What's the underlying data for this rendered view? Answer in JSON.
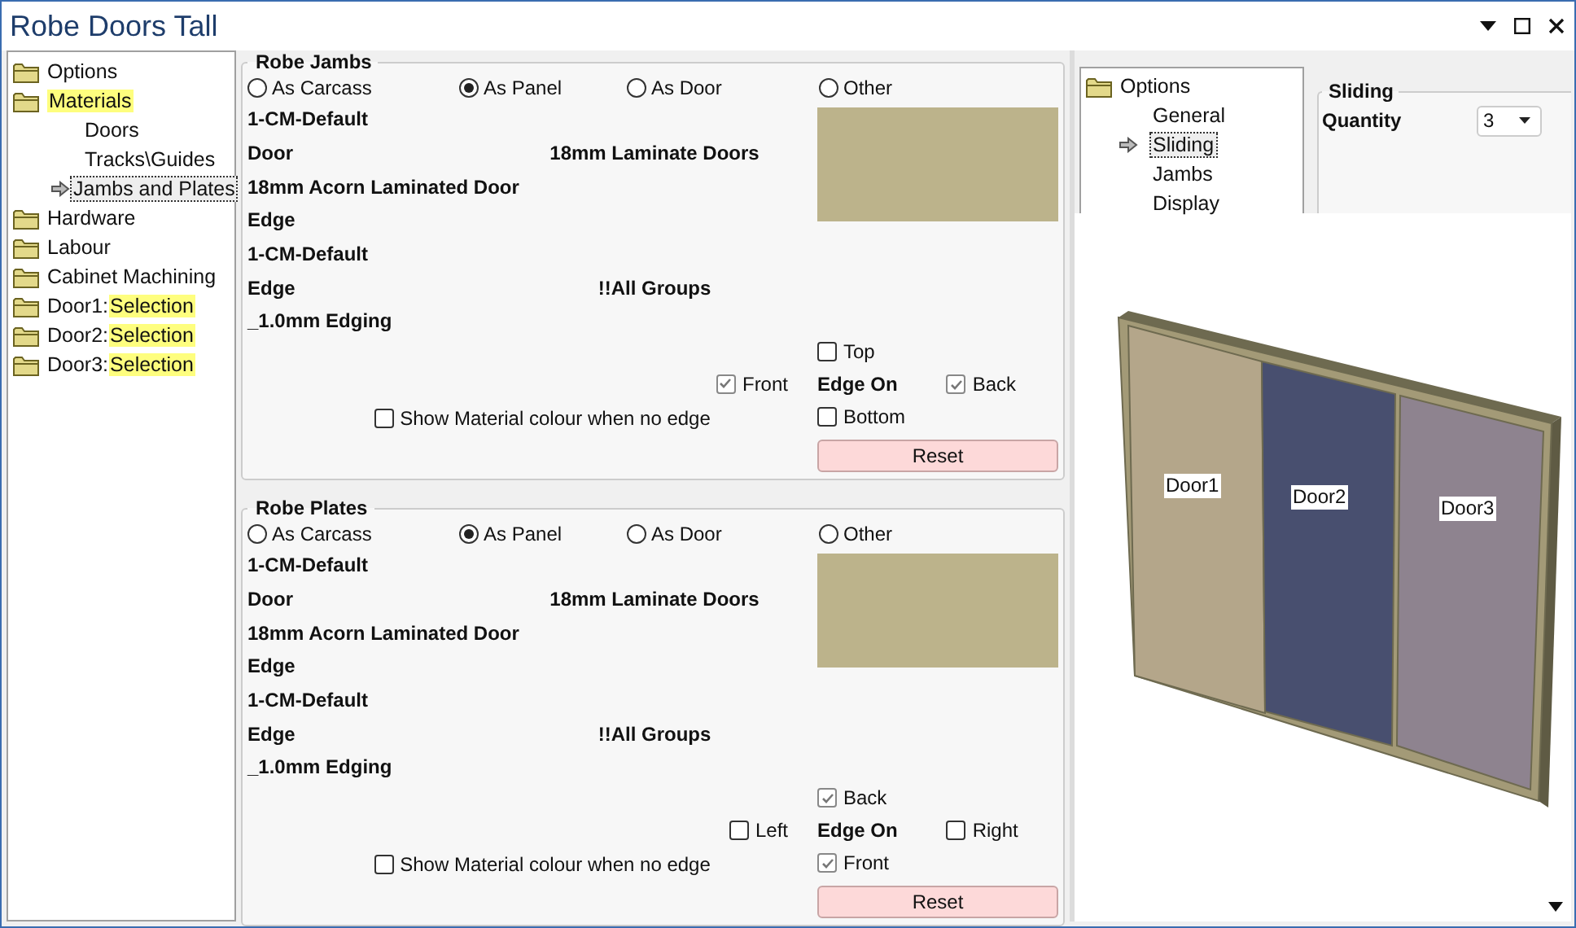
{
  "window": {
    "title": "Robe Doors Tall"
  },
  "tree": [
    {
      "label": "Options",
      "highlighted": false
    },
    {
      "label": "Materials",
      "highlighted": true,
      "children": [
        {
          "label": "Doors",
          "selected": false
        },
        {
          "label": "Tracks\\Guides",
          "selected": false
        },
        {
          "label": "Jambs and Plates",
          "selected": true
        }
      ]
    },
    {
      "label": "Hardware",
      "highlighted": false
    },
    {
      "label": "Labour",
      "highlighted": false
    },
    {
      "label": "Cabinet Machining",
      "highlighted": false
    },
    {
      "label": "Door1:",
      "highlight": "Selection",
      "highlighted": false
    },
    {
      "label": "Door2:",
      "highlight": "Selection",
      "highlighted": false
    },
    {
      "label": "Door3:",
      "highlight": "Selection",
      "highlighted": false
    }
  ],
  "panels": [
    {
      "title": "Robe Jambs",
      "options": [
        {
          "label": "As Carcass",
          "selected": false
        },
        {
          "label": "As Panel",
          "selected": true
        },
        {
          "label": "As Door",
          "selected": false
        },
        {
          "label": "Other",
          "selected": false
        }
      ],
      "lines": [
        {
          "text": "1-CM-Default"
        },
        {
          "text": "Door",
          "value": "18mm Laminate Doors"
        },
        {
          "text": "18mm Acorn Laminated Door"
        },
        {
          "text": "Edge"
        },
        {
          "text": "1-CM-Default"
        },
        {
          "text": "Edge",
          "value": "!!All Groups"
        },
        {
          "text": "_1.0mm Edging"
        }
      ],
      "edge": {
        "label": "Edge On",
        "top": {
          "label": "Top",
          "checked": false
        },
        "left": {
          "label": "Front",
          "checked": true
        },
        "right": {
          "label": "Back",
          "checked": true
        },
        "bottom": {
          "label": "Bottom",
          "checked": false
        }
      },
      "show_colour": {
        "label": "Show Material colour when no edge",
        "checked": false
      },
      "reset": "Reset"
    },
    {
      "title": "Robe Plates",
      "options": [
        {
          "label": "As Carcass",
          "selected": false
        },
        {
          "label": "As Panel",
          "selected": true
        },
        {
          "label": "As Door",
          "selected": false
        },
        {
          "label": "Other",
          "selected": false
        }
      ],
      "lines": [
        {
          "text": "1-CM-Default"
        },
        {
          "text": "Door",
          "value": "18mm Laminate Doors"
        },
        {
          "text": "18mm Acorn Laminated Door"
        },
        {
          "text": "Edge"
        },
        {
          "text": "1-CM-Default"
        },
        {
          "text": "Edge",
          "value": "!!All Groups"
        },
        {
          "text": "_1.0mm Edging"
        }
      ],
      "edge": {
        "label": "Edge On",
        "top": {
          "label": "Back",
          "checked": true
        },
        "left": {
          "label": "Left",
          "checked": false
        },
        "right": {
          "label": "Right",
          "checked": false
        },
        "bottom": {
          "label": "Front",
          "checked": true
        }
      },
      "show_colour": {
        "label": "Show Material colour when no edge",
        "checked": false
      },
      "reset": "Reset"
    }
  ],
  "options_tree": {
    "label": "Options",
    "children": [
      {
        "label": "General",
        "selected": false
      },
      {
        "label": "Sliding",
        "selected": true
      },
      {
        "label": "Jambs",
        "selected": false
      },
      {
        "label": "Display",
        "selected": false
      }
    ]
  },
  "sliding": {
    "title": "Sliding",
    "quantity_label": "Quantity",
    "quantity": "3"
  },
  "preview": {
    "doors": [
      {
        "label": "Door1",
        "color": "#b4a68a"
      },
      {
        "label": "Door2",
        "color": "#484f6f"
      },
      {
        "label": "Door3",
        "color": "#8e838f"
      }
    ]
  }
}
